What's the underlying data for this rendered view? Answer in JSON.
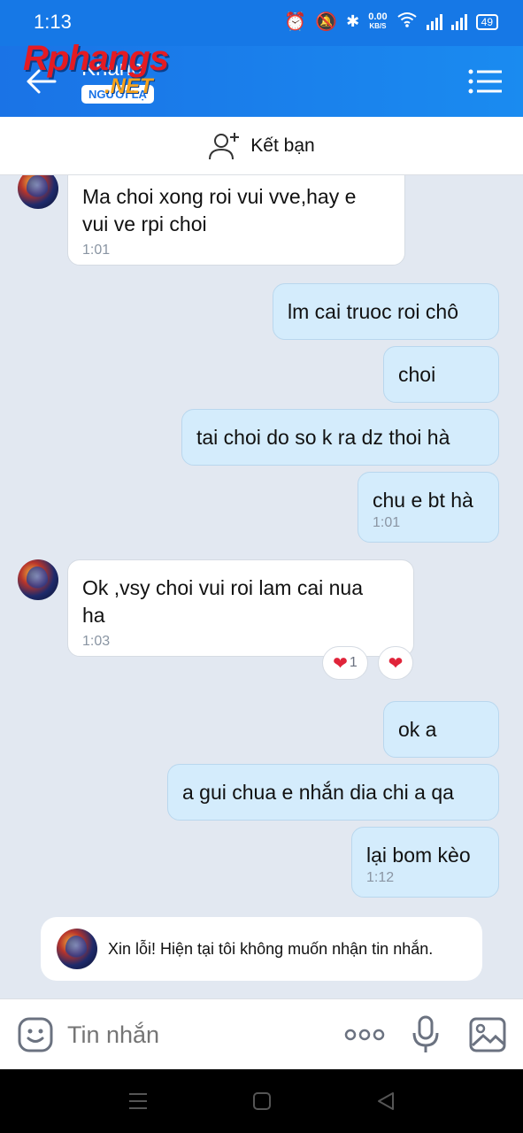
{
  "status_bar": {
    "time": "1:13",
    "speed_value": "0.00",
    "speed_unit": "KB/S",
    "battery": "49"
  },
  "header": {
    "contact_name": "Khánh",
    "badge": "NGƯỜI LẠ",
    "watermark": "Rphangs",
    "watermark_net": ".NET"
  },
  "friend_bar": {
    "label": "Kết bạn"
  },
  "messages": [
    {
      "text_lines": [
        "Ma choi xong roi vui vve,hay e",
        "vui ve rpi choi"
      ],
      "time": "1:01"
    },
    {
      "text": "lm cai truoc roi chô"
    },
    {
      "text": "choi"
    },
    {
      "text": "tai choi do so k ra dz thoi hà"
    },
    {
      "text": "chu e bt hà",
      "time": "1:01"
    },
    {
      "text_lines": [
        "Ok ,vsy choi vui roi lam cai nua",
        "ha"
      ],
      "time": "1:03"
    },
    {
      "text": "ok a"
    },
    {
      "text": "a gui chua e nhắn dia chi a qa"
    },
    {
      "text": "lại bom kèo",
      "time": "1:12"
    }
  ],
  "reactions": {
    "heart_count": "1"
  },
  "system_note": {
    "text": "Xin lỗi! Hiện tại tôi không muốn nhận tin nhắn."
  },
  "input": {
    "placeholder": "Tin nhắn"
  },
  "colors": {
    "header": "#1a73e6",
    "incoming": "#ffffff",
    "outgoing": "#d4ecfc",
    "background": "#e2e8f1"
  }
}
